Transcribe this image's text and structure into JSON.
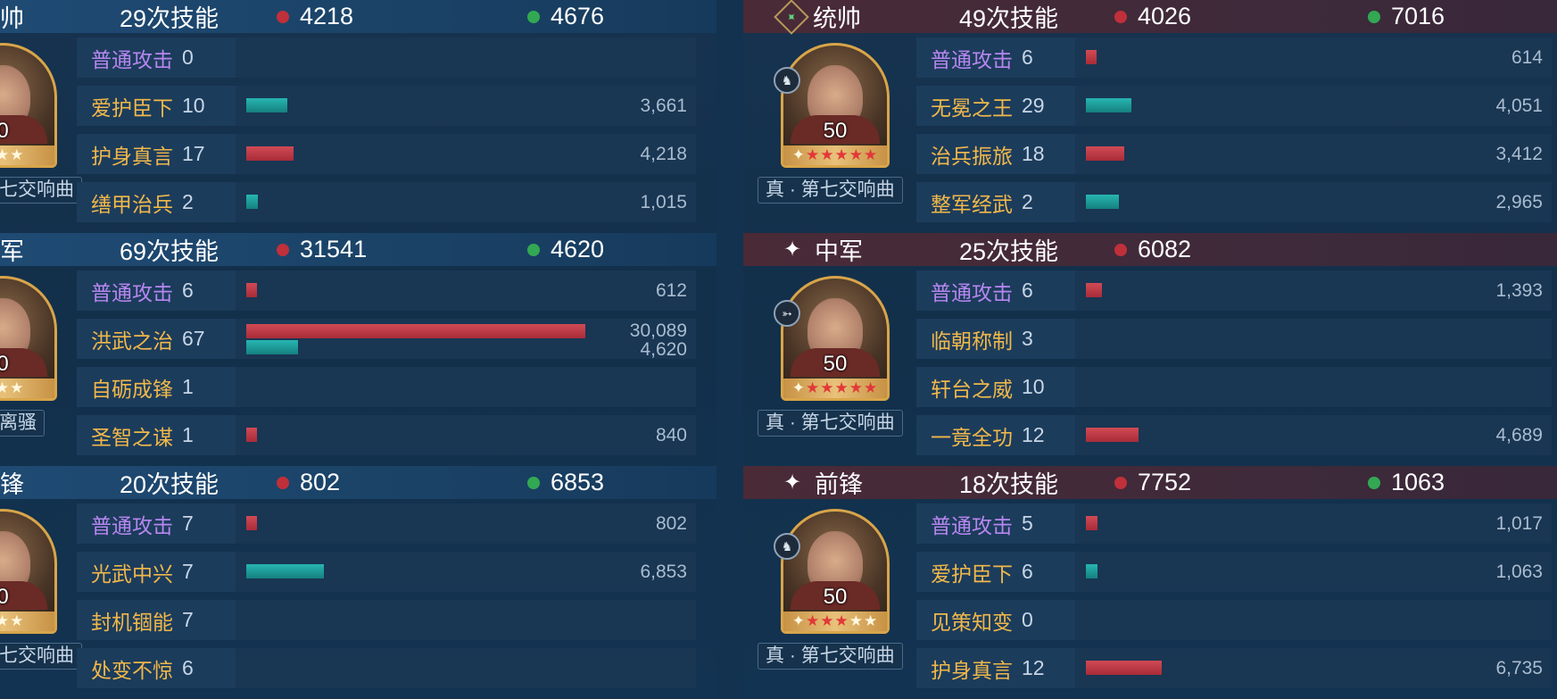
{
  "left_panel": {
    "units": [
      {
        "role": "帅",
        "skills": "29次技能",
        "damage": "4218",
        "heal": "4676",
        "level": "0",
        "tag": "七交响曲",
        "stars": 3,
        "star_total": 3,
        "rows": [
          {
            "name": "普通攻击",
            "type": "normal",
            "count": "0",
            "red": 0,
            "teal": 0,
            "val": ""
          },
          {
            "name": "爱护臣下",
            "type": "special",
            "count": "10",
            "red": 0,
            "teal": 3661,
            "val": "3,661"
          },
          {
            "name": "护身真言",
            "type": "special",
            "count": "17",
            "red": 4218,
            "teal": 0,
            "val": "4,218"
          },
          {
            "name": "缮甲治兵",
            "type": "special",
            "count": "2",
            "red": 0,
            "teal": 1015,
            "val": "1,015"
          }
        ]
      },
      {
        "role": "军",
        "skills": "69次技能",
        "damage": "31541",
        "heal": "4620",
        "level": "0",
        "tag": "离骚",
        "stars": 3,
        "star_total": 3,
        "rows": [
          {
            "name": "普通攻击",
            "type": "normal",
            "count": "6",
            "red": 612,
            "teal": 0,
            "val": "612"
          },
          {
            "name": "洪武之治",
            "type": "special",
            "count": "67",
            "red": 30089,
            "teal": 4620,
            "val": "30,089",
            "val2": "4,620"
          },
          {
            "name": "自砺成锋",
            "type": "special",
            "count": "1",
            "red": 0,
            "teal": 0,
            "val": ""
          },
          {
            "name": "圣智之谋",
            "type": "special",
            "count": "1",
            "red": 840,
            "teal": 0,
            "val": "840"
          }
        ]
      },
      {
        "role": "锋",
        "skills": "20次技能",
        "damage": "802",
        "heal": "6853",
        "level": "0",
        "tag": "七交响曲",
        "stars": 3,
        "star_total": 3,
        "rows": [
          {
            "name": "普通攻击",
            "type": "normal",
            "count": "7",
            "red": 802,
            "teal": 0,
            "val": "802"
          },
          {
            "name": "光武中兴",
            "type": "special",
            "count": "7",
            "red": 0,
            "teal": 6853,
            "val": "6,853"
          },
          {
            "name": "封机锢能",
            "type": "special",
            "count": "7",
            "red": 0,
            "teal": 0,
            "val": ""
          },
          {
            "name": "处变不惊",
            "type": "special",
            "count": "6",
            "red": 0,
            "teal": 0,
            "val": ""
          }
        ]
      }
    ]
  },
  "right_panel": {
    "units": [
      {
        "role": "统帅",
        "role_icon": "green-diamond-icon",
        "skills": "49次技能",
        "damage": "4026",
        "heal": "7016",
        "level": "50",
        "tag": "真 · 第七交响曲",
        "stars": 5,
        "star_total": 5,
        "badge_icon": "cavalry-icon",
        "rows": [
          {
            "name": "普通攻击",
            "type": "normal",
            "count": "6",
            "red": 614,
            "teal": 0,
            "val": "614"
          },
          {
            "name": "无冕之王",
            "type": "special",
            "count": "29",
            "red": 0,
            "teal": 4051,
            "val": "4,051"
          },
          {
            "name": "治兵振旅",
            "type": "special",
            "count": "18",
            "red": 3412,
            "teal": 0,
            "val": "3,412"
          },
          {
            "name": "整军经武",
            "type": "special",
            "count": "2",
            "red": 0,
            "teal": 2965,
            "val": "2,965"
          }
        ]
      },
      {
        "role": "中军",
        "role_icon": "sparkle-icon",
        "skills": "25次技能",
        "damage": "6082",
        "heal": "",
        "level": "50",
        "tag": "真 · 第七交响曲",
        "stars": 5,
        "star_total": 5,
        "badge_icon": "bow-icon",
        "rows": [
          {
            "name": "普通攻击",
            "type": "normal",
            "count": "6",
            "red": 1393,
            "teal": 0,
            "val": "1,393"
          },
          {
            "name": "临朝称制",
            "type": "special",
            "count": "3",
            "red": 0,
            "teal": 0,
            "val": ""
          },
          {
            "name": "轩台之威",
            "type": "special",
            "count": "10",
            "red": 0,
            "teal": 0,
            "val": ""
          },
          {
            "name": "一竟全功",
            "type": "special",
            "count": "12",
            "red": 4689,
            "teal": 0,
            "val": "4,689"
          }
        ]
      },
      {
        "role": "前锋",
        "role_icon": "sparkle-icon",
        "skills": "18次技能",
        "damage": "7752",
        "heal": "1063",
        "level": "50",
        "tag": "真 · 第七交响曲",
        "stars": 3,
        "star_total": 5,
        "badge_icon": "cavalry-icon",
        "rows": [
          {
            "name": "普通攻击",
            "type": "normal",
            "count": "5",
            "red": 1017,
            "teal": 0,
            "val": "1,017"
          },
          {
            "name": "爱护臣下",
            "type": "special",
            "count": "6",
            "red": 0,
            "teal": 1063,
            "val": "1,063"
          },
          {
            "name": "见策知变",
            "type": "special",
            "count": "0",
            "red": 0,
            "teal": 0,
            "val": ""
          },
          {
            "name": "护身真言",
            "type": "special",
            "count": "12",
            "red": 6735,
            "teal": 0,
            "val": "6,735"
          }
        ]
      }
    ]
  },
  "bar_scale_max": 30089,
  "colors": {
    "damage": "#c0303a",
    "heal": "#32a853",
    "normal_skill": "#b787f0",
    "special_skill": "#f0b84a"
  }
}
